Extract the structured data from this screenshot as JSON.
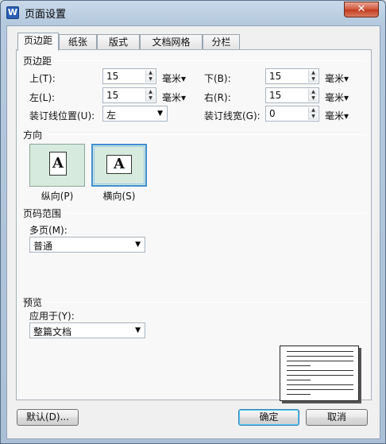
{
  "window": {
    "title": "页面设置",
    "app_icon": "W"
  },
  "tabs": [
    "页边距",
    "纸张",
    "版式",
    "文档网格",
    "分栏"
  ],
  "margins": {
    "section_label": "页边距",
    "top_label": "上(T):",
    "top_value": "15",
    "bottom_label": "下(B):",
    "bottom_value": "15",
    "left_label": "左(L):",
    "left_value": "15",
    "right_label": "右(R):",
    "right_value": "15",
    "gutter_pos_label": "装订线位置(U):",
    "gutter_pos_value": "左",
    "gutter_width_label": "装订线宽(G):",
    "gutter_width_value": "0",
    "unit": "毫米"
  },
  "orientation": {
    "section_label": "方向",
    "portrait_label": "纵向(P)",
    "landscape_label": "横向(S)",
    "glyph": "A",
    "selected": "landscape"
  },
  "page_range": {
    "section_label": "页码范围",
    "multi_label": "多页(M):",
    "multi_value": "普通"
  },
  "preview": {
    "section_label": "预览",
    "apply_label": "应用于(Y):",
    "apply_value": "整篇文档"
  },
  "buttons": {
    "default": "默认(D)...",
    "ok": "确定",
    "cancel": "取消"
  }
}
